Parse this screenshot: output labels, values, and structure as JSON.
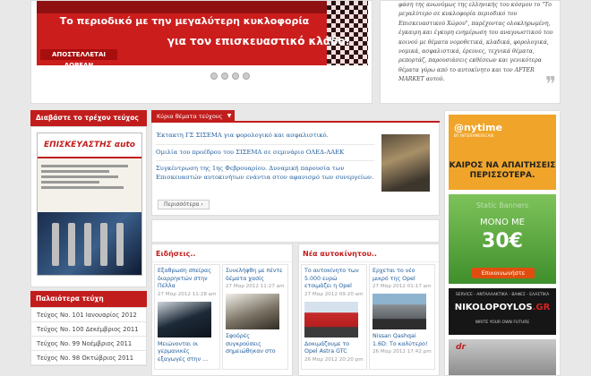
{
  "hero": {
    "line1": "Το περιοδικό με την μεγαλύτερη κυκλοφορία",
    "line2": "για τον επισκευαστικό κλάδο!",
    "free_label": "ΑΠΟΣΤΕΛΛΕΤΑΙ ΔΩΡΕΑΝ",
    "slides": 4
  },
  "quote": {
    "text": "φάση της ανωνύμως της ελληνικής του κόσμου το \"Το μεγαλύτερο σε κυκλοφορία περιοδικό του Επισκευαστικού Χώρου\", παρέχοντας ολοκληρωμένη, έγκαιρη και έγκυρη ενημέρωση του αναγνωστικού του κοινού με θέματα νομοθετικά, κλαδικά, φορολογικά, νομικά, ασφαλιστικά, έρευνες, τεχνικά θέματα, ρεπορτάζ, παρουσιάσεις εκθέσεων και γενικότερα θέματα γύρω από το αυτοκίνητο και τον AFTER MARKET αυτού.",
    "mark": "❞"
  },
  "current_issue": {
    "heading": "Διαβάστε το τρέχον τεύχος",
    "cover_logo": "ΕΠΙΣΚΕΥΑΣΤΗΣ αuto"
  },
  "old_issues": {
    "heading": "Παλαιότερα τεύχη",
    "items": [
      "Τεύχος Νο. 101 Ιανουαρίος 2012",
      "Τεύχος Νο. 100 Δεκέμβριος 2011",
      "Τεύχος Νο. 99 Νοέμβριος 2011",
      "Τεύχος Νο. 98 Οκτώβριος 2011"
    ]
  },
  "main_topics": {
    "tab_label": "Κύρια θέματα τεύχους",
    "links": [
      "Έκτακτη ΓΣ ΣΙΣΕΜΑ για φορολογικό και ασφαλιστικό.",
      "Ομιλία του προέδρου του ΣΙΣΕΜΑ σε σεμινάριο ΟΛΕΔ-ΛΑΕΚ",
      "Συγκέντρωση της 1ης Φεβρουαρίου. Δυναμική παρουσία των Επισκευαστών αυτοκινήτων ενάντια στον αφανισμό των συνεργείων."
    ],
    "more_label": "Περισσότερα"
  },
  "news": {
    "title": "Ειδήσεις..",
    "cards": [
      {
        "title": "Εξαθρωση σπείρας διαρρηκτών στην Πέλλα",
        "date": "27 Μαρ 2012 11:28 am"
      },
      {
        "title": "Συνελήφθη με πέντε δέματα χασίς",
        "date": "27 Μαρ 2012 11:27 am"
      },
      {
        "title": "Μειώνονται οι γερμανικές εξαγωγές στην ..."
      },
      {
        "title": "Σφοδρές συγκρούσεις σημειώθηκαν στο"
      }
    ]
  },
  "cars": {
    "title": "Νέα αυτοκίνητου..",
    "cards": [
      {
        "title": "Το αυτοκίνητο των 5.000 ευρώ ετοιμάζει η Opel",
        "date": "27 Μαρ 2012 09:20 am"
      },
      {
        "title": "Ερχεται το νέο μικρό της Opel",
        "date": "27 Μαρ 2012 01:17 am"
      },
      {
        "title": "Δοκιμάζουμε το Opel Astra GTC",
        "date": "26 Μαρ 2012 20:20 pm"
      },
      {
        "title": "Nissan Qashqai 1.6D: Το καλύτερο!",
        "date": "26 Μαρ 2012 17:42 pm"
      }
    ]
  },
  "ads": {
    "anytime_brand": "@nytime",
    "anytime_sub": "BY INTERAMERICAN",
    "anytime_slogan": "ΚΑΙΡΟΣ ΝΑ ΑΠΑΙΤΗΣΕΙΣ ΠΕΡΙΣΣΟΤΕΡΑ.",
    "static_label": "Static Banners",
    "mono_label": "ΜΟΝΟ ΜΕ",
    "price": "30€",
    "contact_label": "Επικοινωνήστε",
    "nikol_tag": "SERVICE - ΑΝΤΑΛΛΑΚΤΙΚΑ - ΒΑΦΕΣ - ΕΛΑΣΤΙΚΑ",
    "nikol_name_a": "NIKOLOPOYLOS",
    "nikol_name_b": ".GR",
    "nikol_slogan": "WRITE YOUR OWN FUTURE",
    "car_logo": "dr"
  }
}
